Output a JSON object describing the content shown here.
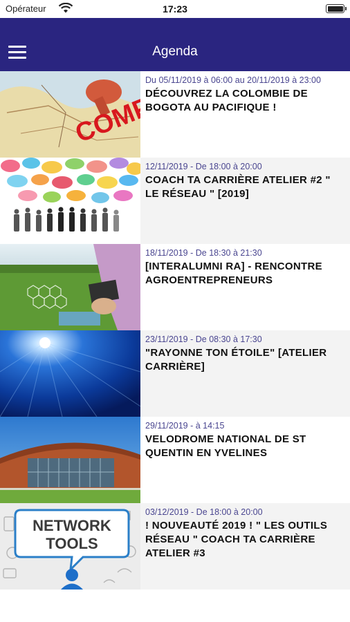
{
  "status_bar": {
    "carrier": "Opérateur",
    "time": "17:23"
  },
  "nav": {
    "title": "Agenda",
    "menu_icon": "hamburger-menu-icon"
  },
  "colors": {
    "nav_background": "#2a2580",
    "date_text": "#4a4690",
    "complet_stamp": "#d8181e"
  },
  "events": [
    {
      "date": "Du 05/11/2019 à 06:00 au 20/11/2019 à 23:00",
      "title": "DÉCOUVREZ LA COLOMBIE DE BOGOTA AU PACIFIQUE !",
      "badge": "COMPLET",
      "thumbnail": "map-with-pin"
    },
    {
      "date": "12/11/2019 - De 18:00 à 20:00",
      "title": "COACH TA CARRIÈRE ATELIER #2 \" LE RÉSEAU \" [2019]",
      "thumbnail": "speech-bubbles-crowd"
    },
    {
      "date": "18/11/2019 - De 18:30 à 21:30",
      "title": "[INTERALUMNI RA] - RENCONTRE AGROENTREPRENEURS",
      "thumbnail": "field-with-tablet"
    },
    {
      "date": "23/11/2019 - De 08:30 à 17:30",
      "title": "\"RAYONNE TON ÉTOILE\" [ATELIER CARRIÈRE]",
      "thumbnail": "blue-light-rays"
    },
    {
      "date": "29/11/2019 - à 14:15",
      "title": "VELODROME NATIONAL DE ST QUENTIN EN YVELINES",
      "thumbnail": "velodrome-building"
    },
    {
      "date": "03/12/2019 - De 18:00 à 20:00",
      "title": "! NOUVEAUTÉ 2019 ! \" LES OUTILS RÉSEAU \" COACH TA CARRIÈRE ATELIER #3",
      "badge": "NETWORK TOOLS",
      "thumbnail": "network-tools-bubble"
    }
  ]
}
